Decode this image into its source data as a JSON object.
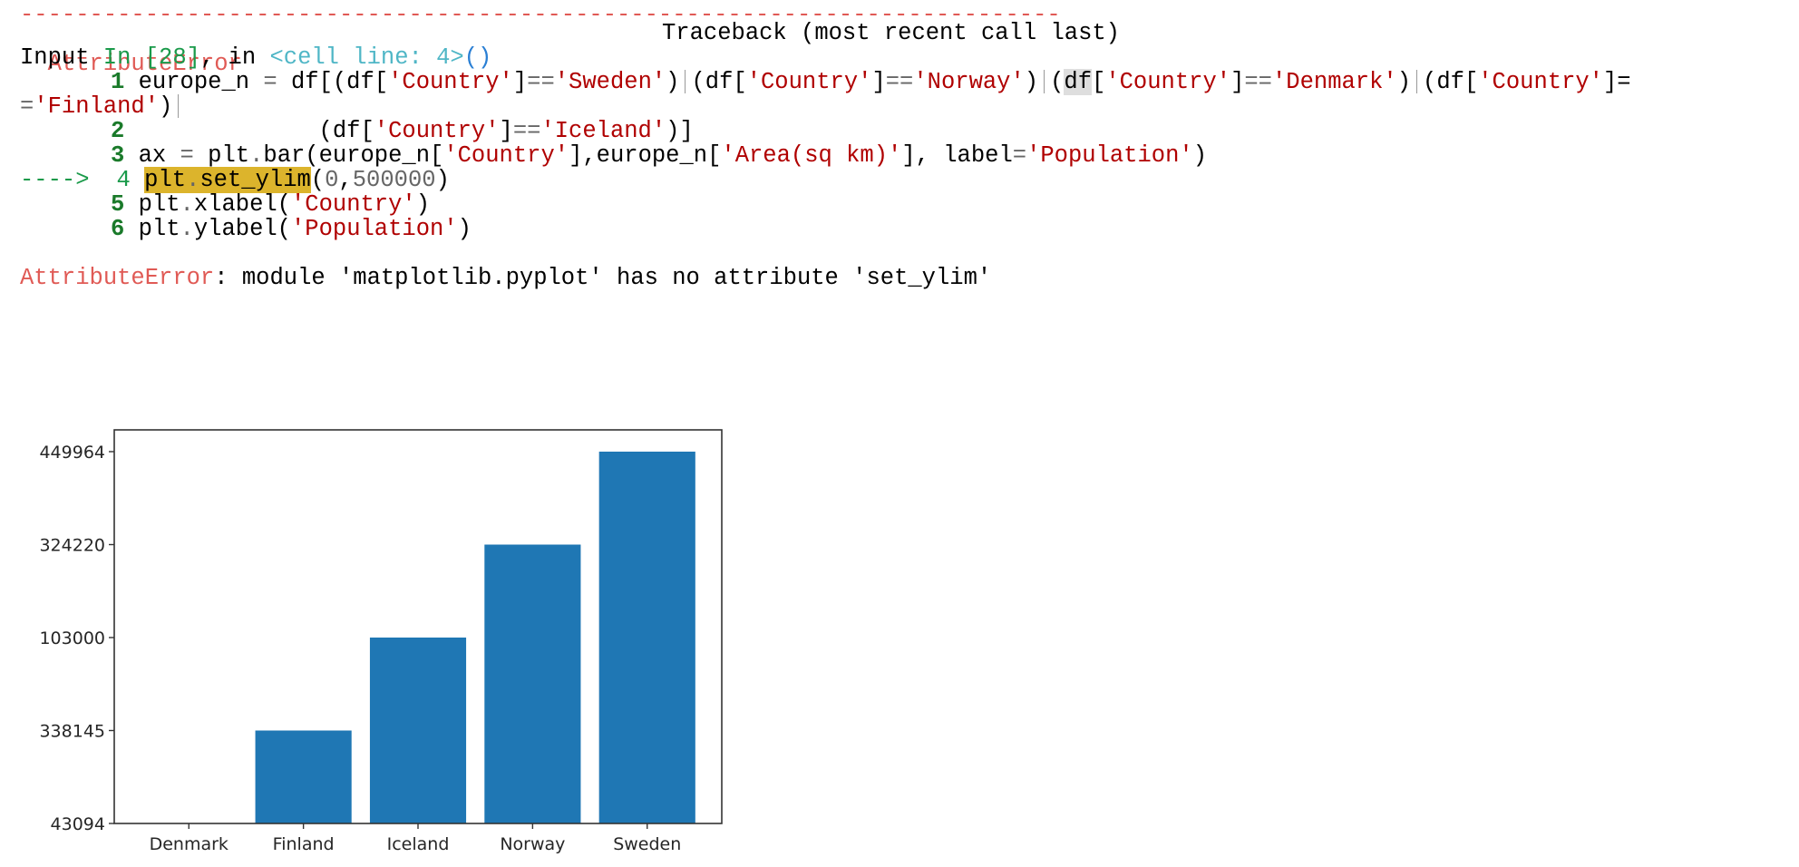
{
  "traceback": {
    "separator": "---------------------------------------------------------------------------",
    "error_name": "AttributeError",
    "header_right": "Traceback (most recent call last)",
    "input_label": "Input",
    "input_ref": "In [28]",
    "in_text": ", in ",
    "cell_ref": "<cell line: 4>",
    "cell_parens": "()",
    "code_lines": [
      {
        "num": "1",
        "current": false
      },
      {
        "num": "2",
        "current": false
      },
      {
        "num": "3",
        "current": false
      },
      {
        "num": "4",
        "current": true,
        "arrow": "---->"
      },
      {
        "num": "5",
        "current": false
      },
      {
        "num": "6",
        "current": false
      }
    ],
    "line1": {
      "a": "europe_n ",
      "eq": "=",
      "b": " df[(df[",
      "s1": "'Country'",
      "c": "]",
      "eqeq": "==",
      "s2": "'Sweden'",
      "d": ")",
      "e": "(df[",
      "s3": "'Country'",
      "f": "]",
      "s4": "'Norway'",
      "g": ")",
      "h": "(",
      "df_hl": "df",
      "i": "[",
      "s5": "'Country'",
      "j": "]",
      "s6": "'Denmark'",
      "k": ")",
      "l": "(df[",
      "s7": "'Country'",
      "m": "]="
    },
    "line1_wrap": {
      "a": "=",
      "s": "'Finland'",
      "b": ")"
    },
    "line2": {
      "a": "             (df[",
      "s1": "'Country'",
      "b": "]",
      "eqeq": "==",
      "s2": "'Iceland'",
      "c": ")]"
    },
    "line3": {
      "a": "ax ",
      "eq": "=",
      "b": " plt",
      "dot": ".",
      "c": "bar(europe_n[",
      "s1": "'Country'",
      "d": "],europe_n[",
      "s2": "'Area(sq km)'",
      "e": "], label",
      "eq2": "=",
      "s3": "'Population'",
      "f": ")"
    },
    "line4": {
      "hl_a": "plt",
      "hl_dot": ".",
      "hl_b": "set_ylim",
      "a": "(",
      "n1": "0",
      "b": ",",
      "n2": "500000",
      "c": ")"
    },
    "line5": {
      "a": "plt",
      "dot": ".",
      "b": "xlabel(",
      "s": "'Country'",
      "c": ")"
    },
    "line6": {
      "a": "plt",
      "dot": ".",
      "b": "ylabel(",
      "s": "'Population'",
      "c": ")"
    },
    "final_error_name": "AttributeError",
    "final_error_msg": ": module 'matplotlib.pyplot' has no attribute 'set_ylim'"
  },
  "colors": {
    "error_red": "#e05a55",
    "bar_blue": "#1f77b4",
    "string_red": "#b00000",
    "highlight": "#dcb42c"
  },
  "chart_data": {
    "type": "bar",
    "title": "",
    "xlabel": "",
    "ylabel": "",
    "categories": [
      "Denmark",
      "Finland",
      "Iceland",
      "Norway",
      "Sweden"
    ],
    "y_axis_kind": "categorical",
    "y_ticks": [
      "43094",
      "338145",
      "103000",
      "324220",
      "449964"
    ],
    "values": [
      "43094",
      "338145",
      "103000",
      "324220",
      "449964"
    ],
    "value_index_on_axis": [
      0,
      1,
      2,
      3,
      4
    ],
    "grid": false,
    "legend": "none"
  }
}
